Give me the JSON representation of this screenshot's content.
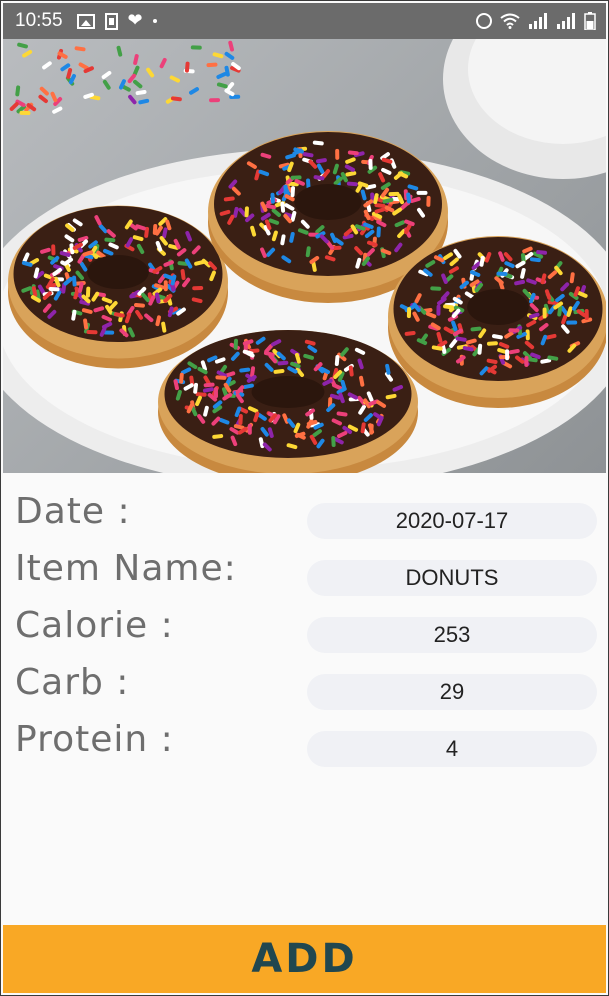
{
  "status_bar": {
    "time": "10:55",
    "left_icons": [
      "image-icon",
      "sim-icon",
      "heart-icon",
      "dot-icon"
    ],
    "right_icons": [
      "alarm-icon",
      "wifi-icon",
      "signal-icon",
      "signal-icon",
      "battery-icon"
    ]
  },
  "hero": {
    "subject": "donuts-with-sprinkles"
  },
  "form": {
    "rows": [
      {
        "label": "Date :",
        "value": "2020-07-17"
      },
      {
        "label": "Item Name:",
        "value": "DONUTS"
      },
      {
        "label": "Calorie :",
        "value": "253"
      },
      {
        "label": "Carb :",
        "value": "29"
      },
      {
        "label": "Protein :",
        "value": "4"
      }
    ]
  },
  "add_button": {
    "label": "ADD"
  },
  "colors": {
    "status_bar": "#6b6b6b",
    "field_bg": "#f0f1f5",
    "label_text": "#6e6e6e",
    "button_bg": "#f9a825",
    "button_text": "#21474f"
  }
}
